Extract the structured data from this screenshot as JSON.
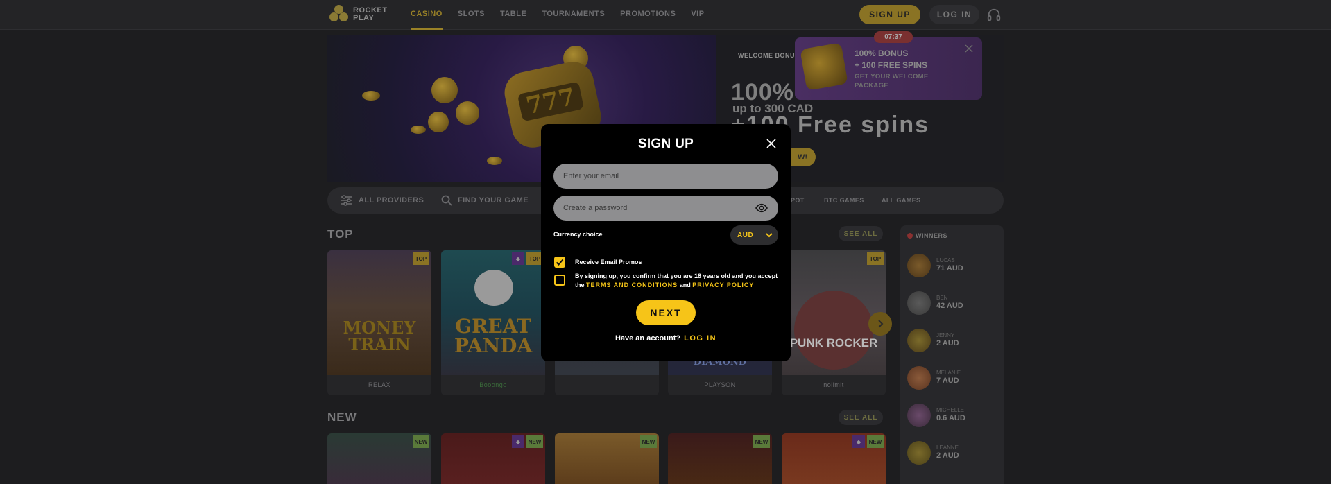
{
  "header": {
    "logo_line1": "ROCKET",
    "logo_line2": "PLAY",
    "nav": [
      {
        "label": "CASINO",
        "active": true
      },
      {
        "label": "SLOTS"
      },
      {
        "label": "TABLE"
      },
      {
        "label": "TOURNAMENTS"
      },
      {
        "label": "PROMOTIONS"
      },
      {
        "label": "VIP"
      }
    ],
    "signup_label": "SIGN UP",
    "login_label": "LOG IN"
  },
  "hero": {
    "welcome": "WELCOME BONUS",
    "big": "100%",
    "sub": "up to 300 CAD",
    "spins": "+100 Free spins",
    "cta": "W!",
    "slot_digits": "777"
  },
  "promo": {
    "timer": "07:37",
    "title_line1": "100% BONUS",
    "title_line2": "+ 100 FREE SPINS",
    "desc_line1": "GET YOUR WELCOME",
    "desc_line2": "PACKAGE"
  },
  "filters": {
    "providers": "ALL PROVIDERS",
    "search": "FIND YOUR GAME",
    "chips": [
      "POT",
      "BTC GAMES",
      "ALL GAMES"
    ]
  },
  "sections": {
    "top": "TOP",
    "new": "NEW",
    "see_all": "SEE ALL"
  },
  "top_games": [
    {
      "title": "MONEY TRAIN",
      "provider": "RELAX",
      "badge": "TOP",
      "gem": false
    },
    {
      "title": "GREAT PANDA",
      "provider": "Booongo",
      "badge": "TOP",
      "gem": true
    },
    {
      "title": "",
      "provider": "",
      "badge": "",
      "gem": false
    },
    {
      "title": "DIAMOND",
      "provider": "PLAYSON",
      "badge": "",
      "gem": false
    },
    {
      "title": "PUNK ROCKER",
      "provider": "nolimit",
      "badge": "TOP",
      "gem": false
    }
  ],
  "new_badge": "NEW",
  "winners": {
    "title": "WINNERS",
    "list": [
      {
        "name": "LUCAS",
        "amount": "71 AUD"
      },
      {
        "name": "BEN",
        "amount": "42 AUD"
      },
      {
        "name": "JENNY",
        "amount": "2 AUD"
      },
      {
        "name": "MELANIE",
        "amount": "7 AUD"
      },
      {
        "name": "MICHELLE",
        "amount": "0.6 AUD"
      },
      {
        "name": "LEANNE",
        "amount": "2 AUD"
      }
    ]
  },
  "modal": {
    "title": "SIGN UP",
    "email_placeholder": "Enter your email",
    "password_placeholder": "Create a password",
    "currency_label": "Currency choice",
    "currency_value": "AUD",
    "promo_label": "Receive Email Promos",
    "terms_prefix": "By signing up, you confirm that you are 18 years old and you accept",
    "terms_the": "the",
    "terms_link": "TERMS AND CONDITIONS",
    "terms_and": "and",
    "privacy_link": "PRIVACY POLICY",
    "next_label": "NEXT",
    "have_account": "Have an account?",
    "login_link": "LOG IN"
  },
  "colors": {
    "accent": "#f6c418",
    "modal_bg": "#000000",
    "page_bg": "#1d1d1f"
  }
}
